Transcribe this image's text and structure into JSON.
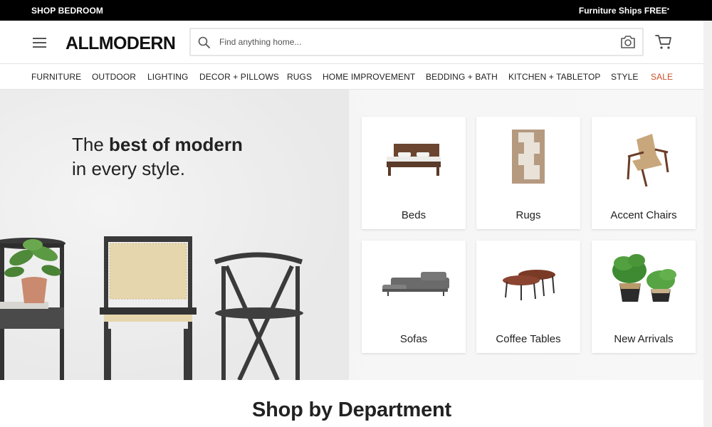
{
  "promo": {
    "left_link": "SHOP BEDROOM",
    "right_text": "Furniture Ships FREE",
    "right_sup": "*"
  },
  "header": {
    "logo": "ALLMODERN",
    "search_placeholder": "Find anything home..."
  },
  "nav": {
    "items": [
      {
        "label": "FURNITURE"
      },
      {
        "label": "OUTDOOR"
      },
      {
        "label": "LIGHTING"
      },
      {
        "label": "DECOR + PILLOWS"
      },
      {
        "label": "RUGS"
      },
      {
        "label": "HOME IMPROVEMENT"
      },
      {
        "label": "BEDDING + BATH"
      },
      {
        "label": "KITCHEN + TABLETOP"
      },
      {
        "label": "STYLE"
      },
      {
        "label": "SALE"
      }
    ],
    "sale_color": "#c8502a"
  },
  "hero": {
    "title_plain": "The ",
    "title_bold": "best of modern",
    "title_line2": "in every style."
  },
  "categories": [
    {
      "label": "Beds",
      "icon": "bed-image"
    },
    {
      "label": "Rugs",
      "icon": "rug-image"
    },
    {
      "label": "Accent Chairs",
      "icon": "accent-chair-image"
    },
    {
      "label": "Sofas",
      "icon": "sofa-image"
    },
    {
      "label": "Coffee Tables",
      "icon": "coffee-table-image"
    },
    {
      "label": "New Arrivals",
      "icon": "plants-image"
    }
  ],
  "section": {
    "title": "Shop by Department"
  }
}
